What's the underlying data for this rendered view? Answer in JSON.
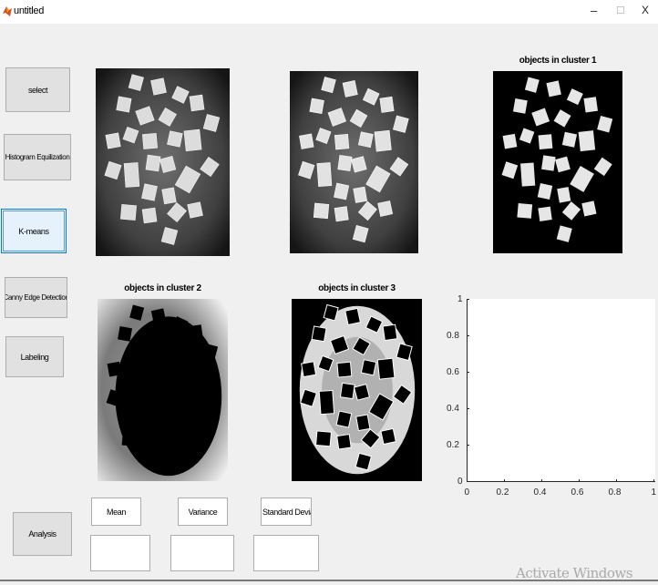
{
  "window": {
    "title": "untitled",
    "controls": {
      "minimize": "–",
      "maximize": "☐",
      "close": "X"
    }
  },
  "sidebar": {
    "select": "select",
    "histogram": "Histogram Equilization",
    "kmeans": "K-means",
    "canny": "Canny Edge Detection",
    "labeling": "Labeling",
    "analysis": "Analysis"
  },
  "panels": {
    "cluster1_title": "objects in cluster 1",
    "cluster2_title": "objects in cluster 2",
    "cluster3_title": "objects in cluster 3"
  },
  "stats": {
    "mean_label": "Mean",
    "variance_label": "Variance",
    "std_label": "Standard Deviation",
    "mean_value": "",
    "variance_value": "",
    "std_value": ""
  },
  "axes": {
    "x_ticks": [
      "0",
      "0.2",
      "0.4",
      "0.6",
      "0.8",
      "1"
    ],
    "y_ticks": [
      "0",
      "0.2",
      "0.4",
      "0.6",
      "0.8",
      "1"
    ]
  },
  "watermark": "Activate Windows",
  "colors": {
    "active_border": "#0078d7",
    "active_fill": "#e5f1fb"
  }
}
